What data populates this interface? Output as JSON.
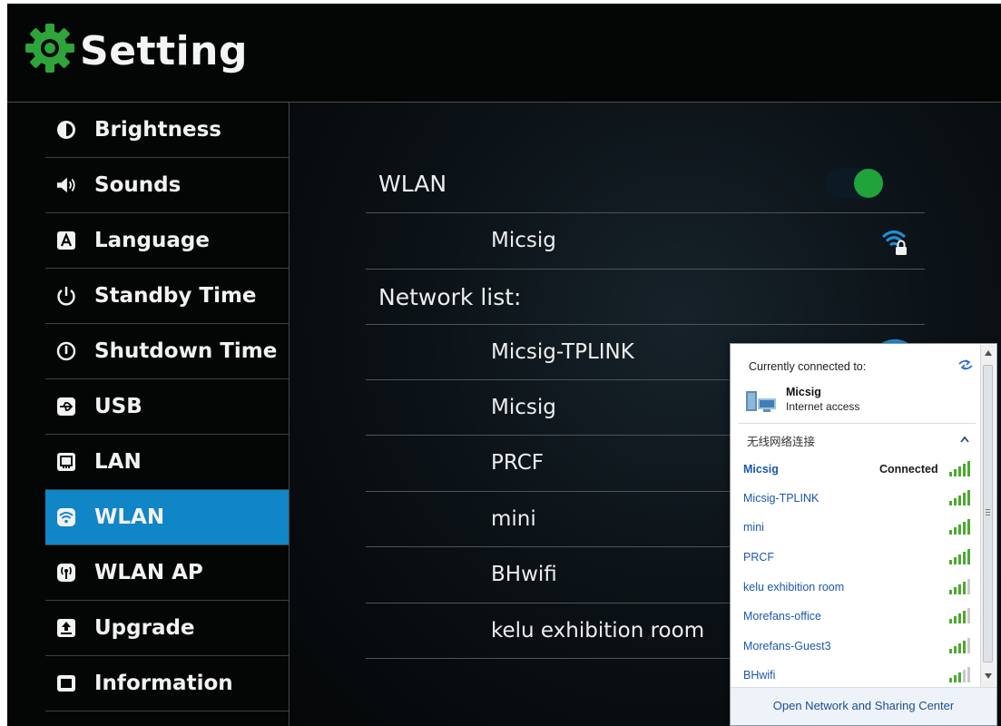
{
  "app": {
    "title": "Setting"
  },
  "sidebar": {
    "items": [
      {
        "label": "Brightness",
        "icon": "brightness-icon"
      },
      {
        "label": "Sounds",
        "icon": "speaker-icon"
      },
      {
        "label": "Language",
        "icon": "language-icon"
      },
      {
        "label": "Standby Time",
        "icon": "power-icon"
      },
      {
        "label": "Shutdown Time",
        "icon": "shutdown-icon"
      },
      {
        "label": "USB",
        "icon": "usb-icon"
      },
      {
        "label": "LAN",
        "icon": "lan-icon"
      },
      {
        "label": "WLAN",
        "icon": "wifi-icon",
        "active": true
      },
      {
        "label": "WLAN AP",
        "icon": "hotspot-icon"
      },
      {
        "label": "Upgrade",
        "icon": "upgrade-icon"
      },
      {
        "label": "Information",
        "icon": "info-icon"
      }
    ]
  },
  "content": {
    "wlan_label": "WLAN",
    "wlan_enabled": true,
    "connected_network": "Micsig",
    "network_list_label": "Network list:",
    "networks": [
      "Micsig-TPLINK",
      "Micsig",
      "PRCF",
      "mini",
      "BHwifi",
      "kelu exhibition room"
    ]
  },
  "popup": {
    "header": "Currently connected to:",
    "current_name": "Micsig",
    "current_status": "Internet access",
    "section_title": "无线网络连接",
    "networks": [
      {
        "name": "Micsig",
        "status": "Connected"
      },
      {
        "name": "Micsig-TPLINK"
      },
      {
        "name": "mini"
      },
      {
        "name": "PRCF"
      },
      {
        "name": "kelu exhibition room"
      },
      {
        "name": "Morefans-office"
      },
      {
        "name": "Morefans-Guest3"
      },
      {
        "name": "BHwifi"
      }
    ],
    "footer_link": "Open Network and Sharing Center"
  },
  "colors": {
    "background": "#040606",
    "active_item": "#1186c6",
    "toggle_on": "#1fa33a",
    "wifi_icon": "#1e90d6",
    "link": "#1c57a8"
  }
}
